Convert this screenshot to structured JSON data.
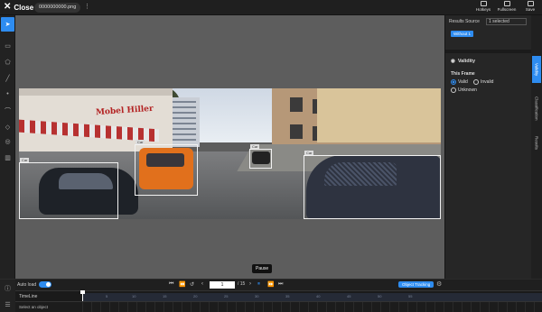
{
  "header": {
    "close_label": "Close",
    "filename": "0000000000.png",
    "buttons": [
      {
        "label": "Hotkeys",
        "icon": "keyboard-icon"
      },
      {
        "label": "Fullscreen",
        "icon": "fullscreen-icon"
      },
      {
        "label": "Save",
        "icon": "save-icon"
      }
    ]
  },
  "canvas": {
    "labels": [
      "Car",
      "Car",
      "Car",
      "Car"
    ]
  },
  "right_panel": {
    "results_source_label": "Results Source",
    "results_source_value": "1 selected",
    "chip": "Without 1",
    "validity_title": "Validity",
    "frame_label": "This Frame",
    "options": [
      "Valid",
      "Invalid",
      "Unknown"
    ],
    "selected_option": "Valid",
    "side_tabs": [
      "Validity",
      "Classification",
      "Results"
    ]
  },
  "tooltip": "Pause",
  "controls": {
    "auto_load_label": "Auto load",
    "auto_load_on": true,
    "current_frame": "1",
    "total_frames": "/ 15",
    "object_tracking_label": "Object Tracking"
  },
  "timeline": {
    "label": "TimeLine",
    "ticks": [
      "5",
      "10",
      "15",
      "20",
      "25",
      "30",
      "35",
      "40",
      "45",
      "50",
      "55"
    ]
  },
  "status": {
    "select_hint": "Select an object"
  },
  "colors": {
    "accent": "#2e8cf0",
    "background": "#2b2b2b",
    "canvas": "#5d5d5d"
  }
}
